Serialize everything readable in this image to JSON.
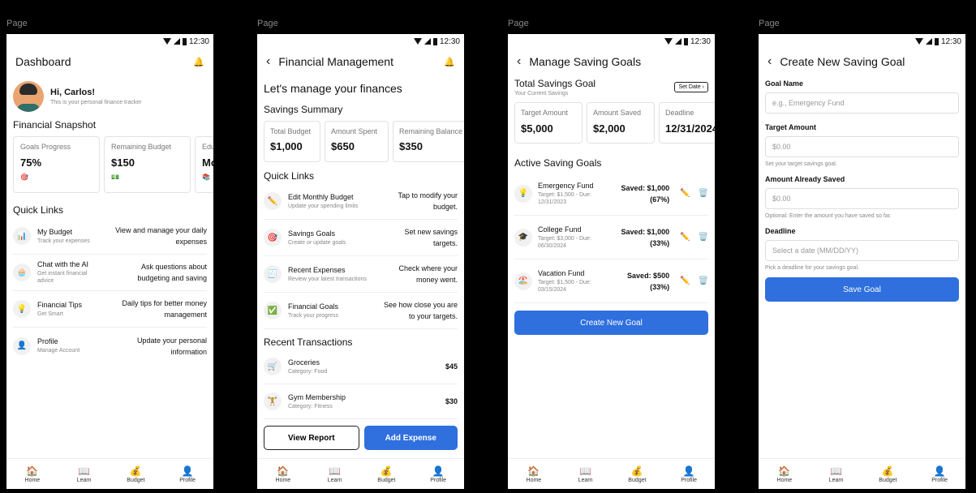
{
  "page_label": "Page",
  "status": {
    "time": "12:30"
  },
  "nav": [
    {
      "icon": "🏠",
      "label": "Home"
    },
    {
      "icon": "📖",
      "label": "Learn"
    },
    {
      "icon": "💰",
      "label": "Budget"
    },
    {
      "icon": "👤",
      "label": "Profile"
    }
  ],
  "bell_icon": "🔔",
  "back_icon": "‹",
  "dashboard": {
    "title": "Dashboard",
    "greeting": "Hi, Carlos!",
    "greeting_sub": "This is your personal finance tracker",
    "snapshot_title": "Financial Snapshot",
    "cards": [
      {
        "label": "Goals Progress",
        "value": "75%",
        "icon": "🎯"
      },
      {
        "label": "Remaining Budget",
        "value": "$150",
        "icon": "💵"
      },
      {
        "label": "Edu",
        "value": "Mo",
        "icon": "📚"
      }
    ],
    "quick_links_title": "Quick Links",
    "quick_links": [
      {
        "icon": "📊",
        "title": "My Budget",
        "sub": "Track your expenses",
        "right": "View and manage your daily expenses"
      },
      {
        "icon": "🧁",
        "title": "Chat with the AI",
        "sub": "Get instant financial advice",
        "right": "Ask questions about budgeting and saving"
      },
      {
        "icon": "💡",
        "title": "Financial Tips",
        "sub": "Get Smart",
        "right": "Daily tips for better money management"
      },
      {
        "icon": "👤",
        "title": "Profile",
        "sub": "Manage Account",
        "right": "Update your personal information"
      }
    ]
  },
  "financial": {
    "title": "Financial Management",
    "heading": "Let's manage your finances",
    "summary_title": "Savings Summary",
    "summary": [
      {
        "label": "Total Budget",
        "value": "$1,000"
      },
      {
        "label": "Amount Spent",
        "value": "$650"
      },
      {
        "label": "Remaining Balance",
        "value": "$350"
      }
    ],
    "quick_links_title": "Quick Links",
    "quick_links": [
      {
        "icon": "✏️",
        "title": "Edit Monthly Budget",
        "sub": "Update your spending limits",
        "right": "Tap to modify your budget."
      },
      {
        "icon": "🎯",
        "title": "Savings Goals",
        "sub": "Create or update goals",
        "right": "Set new savings targets."
      },
      {
        "icon": "🧾",
        "title": "Recent Expenses",
        "sub": "Review your latest transactions",
        "right": "Check where your money went."
      },
      {
        "icon": "✅",
        "title": "Financial Goals",
        "sub": "Track your progress",
        "right": "See how close you are to your targets."
      }
    ],
    "transactions_title": "Recent Transactions",
    "transactions": [
      {
        "icon": "🛒",
        "title": "Groceries",
        "sub": "Category: Food",
        "amount": "$45"
      },
      {
        "icon": "🏋️",
        "title": "Gym Membership",
        "sub": "Category: Fitness",
        "amount": "$30"
      }
    ],
    "view_report": "View Report",
    "add_expense": "Add Expense"
  },
  "saving_goals": {
    "title": "Manage Saving Goals",
    "total_title": "Total Savings Goal",
    "total_sub": "Your Current Savings",
    "set_date": "Set Date ›",
    "cards": [
      {
        "label": "Target Amount",
        "value": "$5,000"
      },
      {
        "label": "Amount Saved",
        "value": "$2,000"
      },
      {
        "label": "Deadline",
        "value": "12/31/2024"
      }
    ],
    "active_title": "Active Saving Goals",
    "goals": [
      {
        "icon": "💡",
        "title": "Emergency Fund",
        "sub": "Target: $1,500 - Due: 12/31/2023",
        "saved": "Saved: $1,000",
        "pct": "(67%)"
      },
      {
        "icon": "🎓",
        "title": "College Fund",
        "sub": "Target: $3,000 - Due: 06/30/2024",
        "saved": "Saved: $1,000",
        "pct": "(33%)"
      },
      {
        "icon": "🏖️",
        "title": "Vacation Fund",
        "sub": "Target: $1,500 - Due: 03/15/2024",
        "saved": "Saved: $500",
        "pct": "(33%)"
      }
    ],
    "edit_icon": "✏️",
    "delete_icon": "🗑️",
    "create_button": "Create New Goal"
  },
  "create_goal": {
    "title": "Create New Saving Goal",
    "fields": [
      {
        "label": "Goal Name",
        "placeholder": "e.g., Emergency Fund",
        "help": ""
      },
      {
        "label": "Target Amount",
        "placeholder": "$0.00",
        "help": "Set your target savings goal."
      },
      {
        "label": "Amount Already Saved",
        "placeholder": "$0.00",
        "help": "Optional: Enter the amount you have saved so far."
      },
      {
        "label": "Deadline",
        "placeholder": "Select a date (MM/DD/YY)",
        "help": "Pick a deadline for your savings goal."
      }
    ],
    "save_button": "Save Goal"
  }
}
